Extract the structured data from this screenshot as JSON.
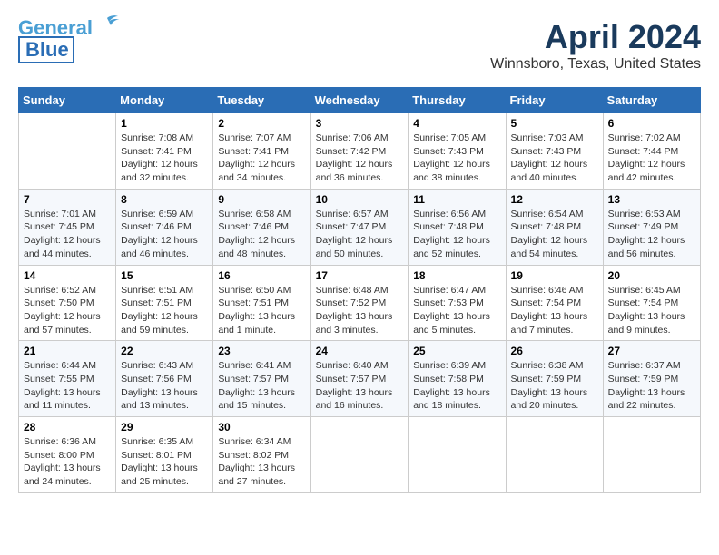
{
  "header": {
    "logo_line1": "General",
    "logo_line2": "Blue",
    "month": "April 2024",
    "location": "Winnsboro, Texas, United States"
  },
  "columns": [
    "Sunday",
    "Monday",
    "Tuesday",
    "Wednesday",
    "Thursday",
    "Friday",
    "Saturday"
  ],
  "weeks": [
    [
      {
        "num": "",
        "info": ""
      },
      {
        "num": "1",
        "info": "Sunrise: 7:08 AM\nSunset: 7:41 PM\nDaylight: 12 hours\nand 32 minutes."
      },
      {
        "num": "2",
        "info": "Sunrise: 7:07 AM\nSunset: 7:41 PM\nDaylight: 12 hours\nand 34 minutes."
      },
      {
        "num": "3",
        "info": "Sunrise: 7:06 AM\nSunset: 7:42 PM\nDaylight: 12 hours\nand 36 minutes."
      },
      {
        "num": "4",
        "info": "Sunrise: 7:05 AM\nSunset: 7:43 PM\nDaylight: 12 hours\nand 38 minutes."
      },
      {
        "num": "5",
        "info": "Sunrise: 7:03 AM\nSunset: 7:43 PM\nDaylight: 12 hours\nand 40 minutes."
      },
      {
        "num": "6",
        "info": "Sunrise: 7:02 AM\nSunset: 7:44 PM\nDaylight: 12 hours\nand 42 minutes."
      }
    ],
    [
      {
        "num": "7",
        "info": "Sunrise: 7:01 AM\nSunset: 7:45 PM\nDaylight: 12 hours\nand 44 minutes."
      },
      {
        "num": "8",
        "info": "Sunrise: 6:59 AM\nSunset: 7:46 PM\nDaylight: 12 hours\nand 46 minutes."
      },
      {
        "num": "9",
        "info": "Sunrise: 6:58 AM\nSunset: 7:46 PM\nDaylight: 12 hours\nand 48 minutes."
      },
      {
        "num": "10",
        "info": "Sunrise: 6:57 AM\nSunset: 7:47 PM\nDaylight: 12 hours\nand 50 minutes."
      },
      {
        "num": "11",
        "info": "Sunrise: 6:56 AM\nSunset: 7:48 PM\nDaylight: 12 hours\nand 52 minutes."
      },
      {
        "num": "12",
        "info": "Sunrise: 6:54 AM\nSunset: 7:48 PM\nDaylight: 12 hours\nand 54 minutes."
      },
      {
        "num": "13",
        "info": "Sunrise: 6:53 AM\nSunset: 7:49 PM\nDaylight: 12 hours\nand 56 minutes."
      }
    ],
    [
      {
        "num": "14",
        "info": "Sunrise: 6:52 AM\nSunset: 7:50 PM\nDaylight: 12 hours\nand 57 minutes."
      },
      {
        "num": "15",
        "info": "Sunrise: 6:51 AM\nSunset: 7:51 PM\nDaylight: 12 hours\nand 59 minutes."
      },
      {
        "num": "16",
        "info": "Sunrise: 6:50 AM\nSunset: 7:51 PM\nDaylight: 13 hours\nand 1 minute."
      },
      {
        "num": "17",
        "info": "Sunrise: 6:48 AM\nSunset: 7:52 PM\nDaylight: 13 hours\nand 3 minutes."
      },
      {
        "num": "18",
        "info": "Sunrise: 6:47 AM\nSunset: 7:53 PM\nDaylight: 13 hours\nand 5 minutes."
      },
      {
        "num": "19",
        "info": "Sunrise: 6:46 AM\nSunset: 7:54 PM\nDaylight: 13 hours\nand 7 minutes."
      },
      {
        "num": "20",
        "info": "Sunrise: 6:45 AM\nSunset: 7:54 PM\nDaylight: 13 hours\nand 9 minutes."
      }
    ],
    [
      {
        "num": "21",
        "info": "Sunrise: 6:44 AM\nSunset: 7:55 PM\nDaylight: 13 hours\nand 11 minutes."
      },
      {
        "num": "22",
        "info": "Sunrise: 6:43 AM\nSunset: 7:56 PM\nDaylight: 13 hours\nand 13 minutes."
      },
      {
        "num": "23",
        "info": "Sunrise: 6:41 AM\nSunset: 7:57 PM\nDaylight: 13 hours\nand 15 minutes."
      },
      {
        "num": "24",
        "info": "Sunrise: 6:40 AM\nSunset: 7:57 PM\nDaylight: 13 hours\nand 16 minutes."
      },
      {
        "num": "25",
        "info": "Sunrise: 6:39 AM\nSunset: 7:58 PM\nDaylight: 13 hours\nand 18 minutes."
      },
      {
        "num": "26",
        "info": "Sunrise: 6:38 AM\nSunset: 7:59 PM\nDaylight: 13 hours\nand 20 minutes."
      },
      {
        "num": "27",
        "info": "Sunrise: 6:37 AM\nSunset: 7:59 PM\nDaylight: 13 hours\nand 22 minutes."
      }
    ],
    [
      {
        "num": "28",
        "info": "Sunrise: 6:36 AM\nSunset: 8:00 PM\nDaylight: 13 hours\nand 24 minutes."
      },
      {
        "num": "29",
        "info": "Sunrise: 6:35 AM\nSunset: 8:01 PM\nDaylight: 13 hours\nand 25 minutes."
      },
      {
        "num": "30",
        "info": "Sunrise: 6:34 AM\nSunset: 8:02 PM\nDaylight: 13 hours\nand 27 minutes."
      },
      {
        "num": "",
        "info": ""
      },
      {
        "num": "",
        "info": ""
      },
      {
        "num": "",
        "info": ""
      },
      {
        "num": "",
        "info": ""
      }
    ]
  ]
}
